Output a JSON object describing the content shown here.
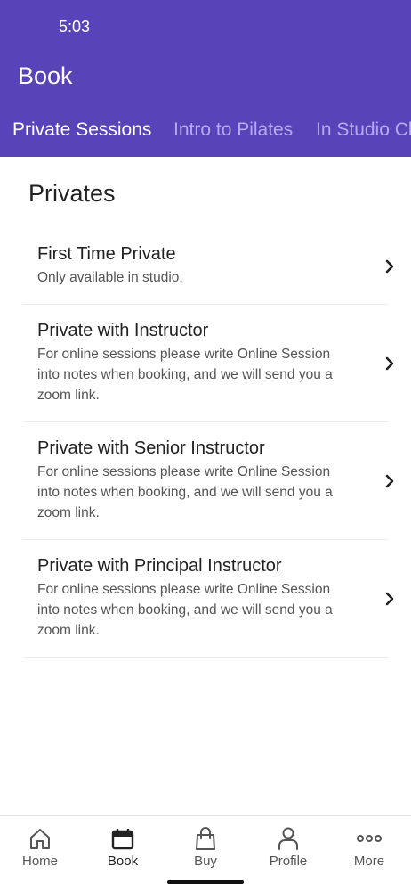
{
  "status_bar": {
    "time": "5:03"
  },
  "header": {
    "title": "Book"
  },
  "tabs": [
    {
      "label": "Private Sessions",
      "active": true
    },
    {
      "label": "Intro to Pilates",
      "active": false
    },
    {
      "label": "In Studio Cl",
      "active": false
    }
  ],
  "section": {
    "title": "Privates"
  },
  "items": [
    {
      "title": "First Time Private",
      "description": "Only available in studio."
    },
    {
      "title": "Private with Instructor",
      "description": "For online sessions please write Online Session into notes when booking, and we will send you a zoom link."
    },
    {
      "title": "Private with Senior Instructor",
      "description": "For online sessions please write Online Session into notes when booking, and we will send you a zoom link."
    },
    {
      "title": "Private with Principal Instructor",
      "description": "For online sessions please write Online Session into notes when booking, and we will send you a zoom link."
    }
  ],
  "bottom_nav": [
    {
      "label": "Home",
      "icon": "home-icon",
      "active": false
    },
    {
      "label": "Book",
      "icon": "calendar-icon",
      "active": true
    },
    {
      "label": "Buy",
      "icon": "shopping-bag-icon",
      "active": false
    },
    {
      "label": "Profile",
      "icon": "person-icon",
      "active": false
    },
    {
      "label": "More",
      "icon": "more-dots-icon",
      "active": false
    }
  ],
  "colors": {
    "header_bg": "#5943b8",
    "tab_inactive": "#b7aaf0"
  }
}
